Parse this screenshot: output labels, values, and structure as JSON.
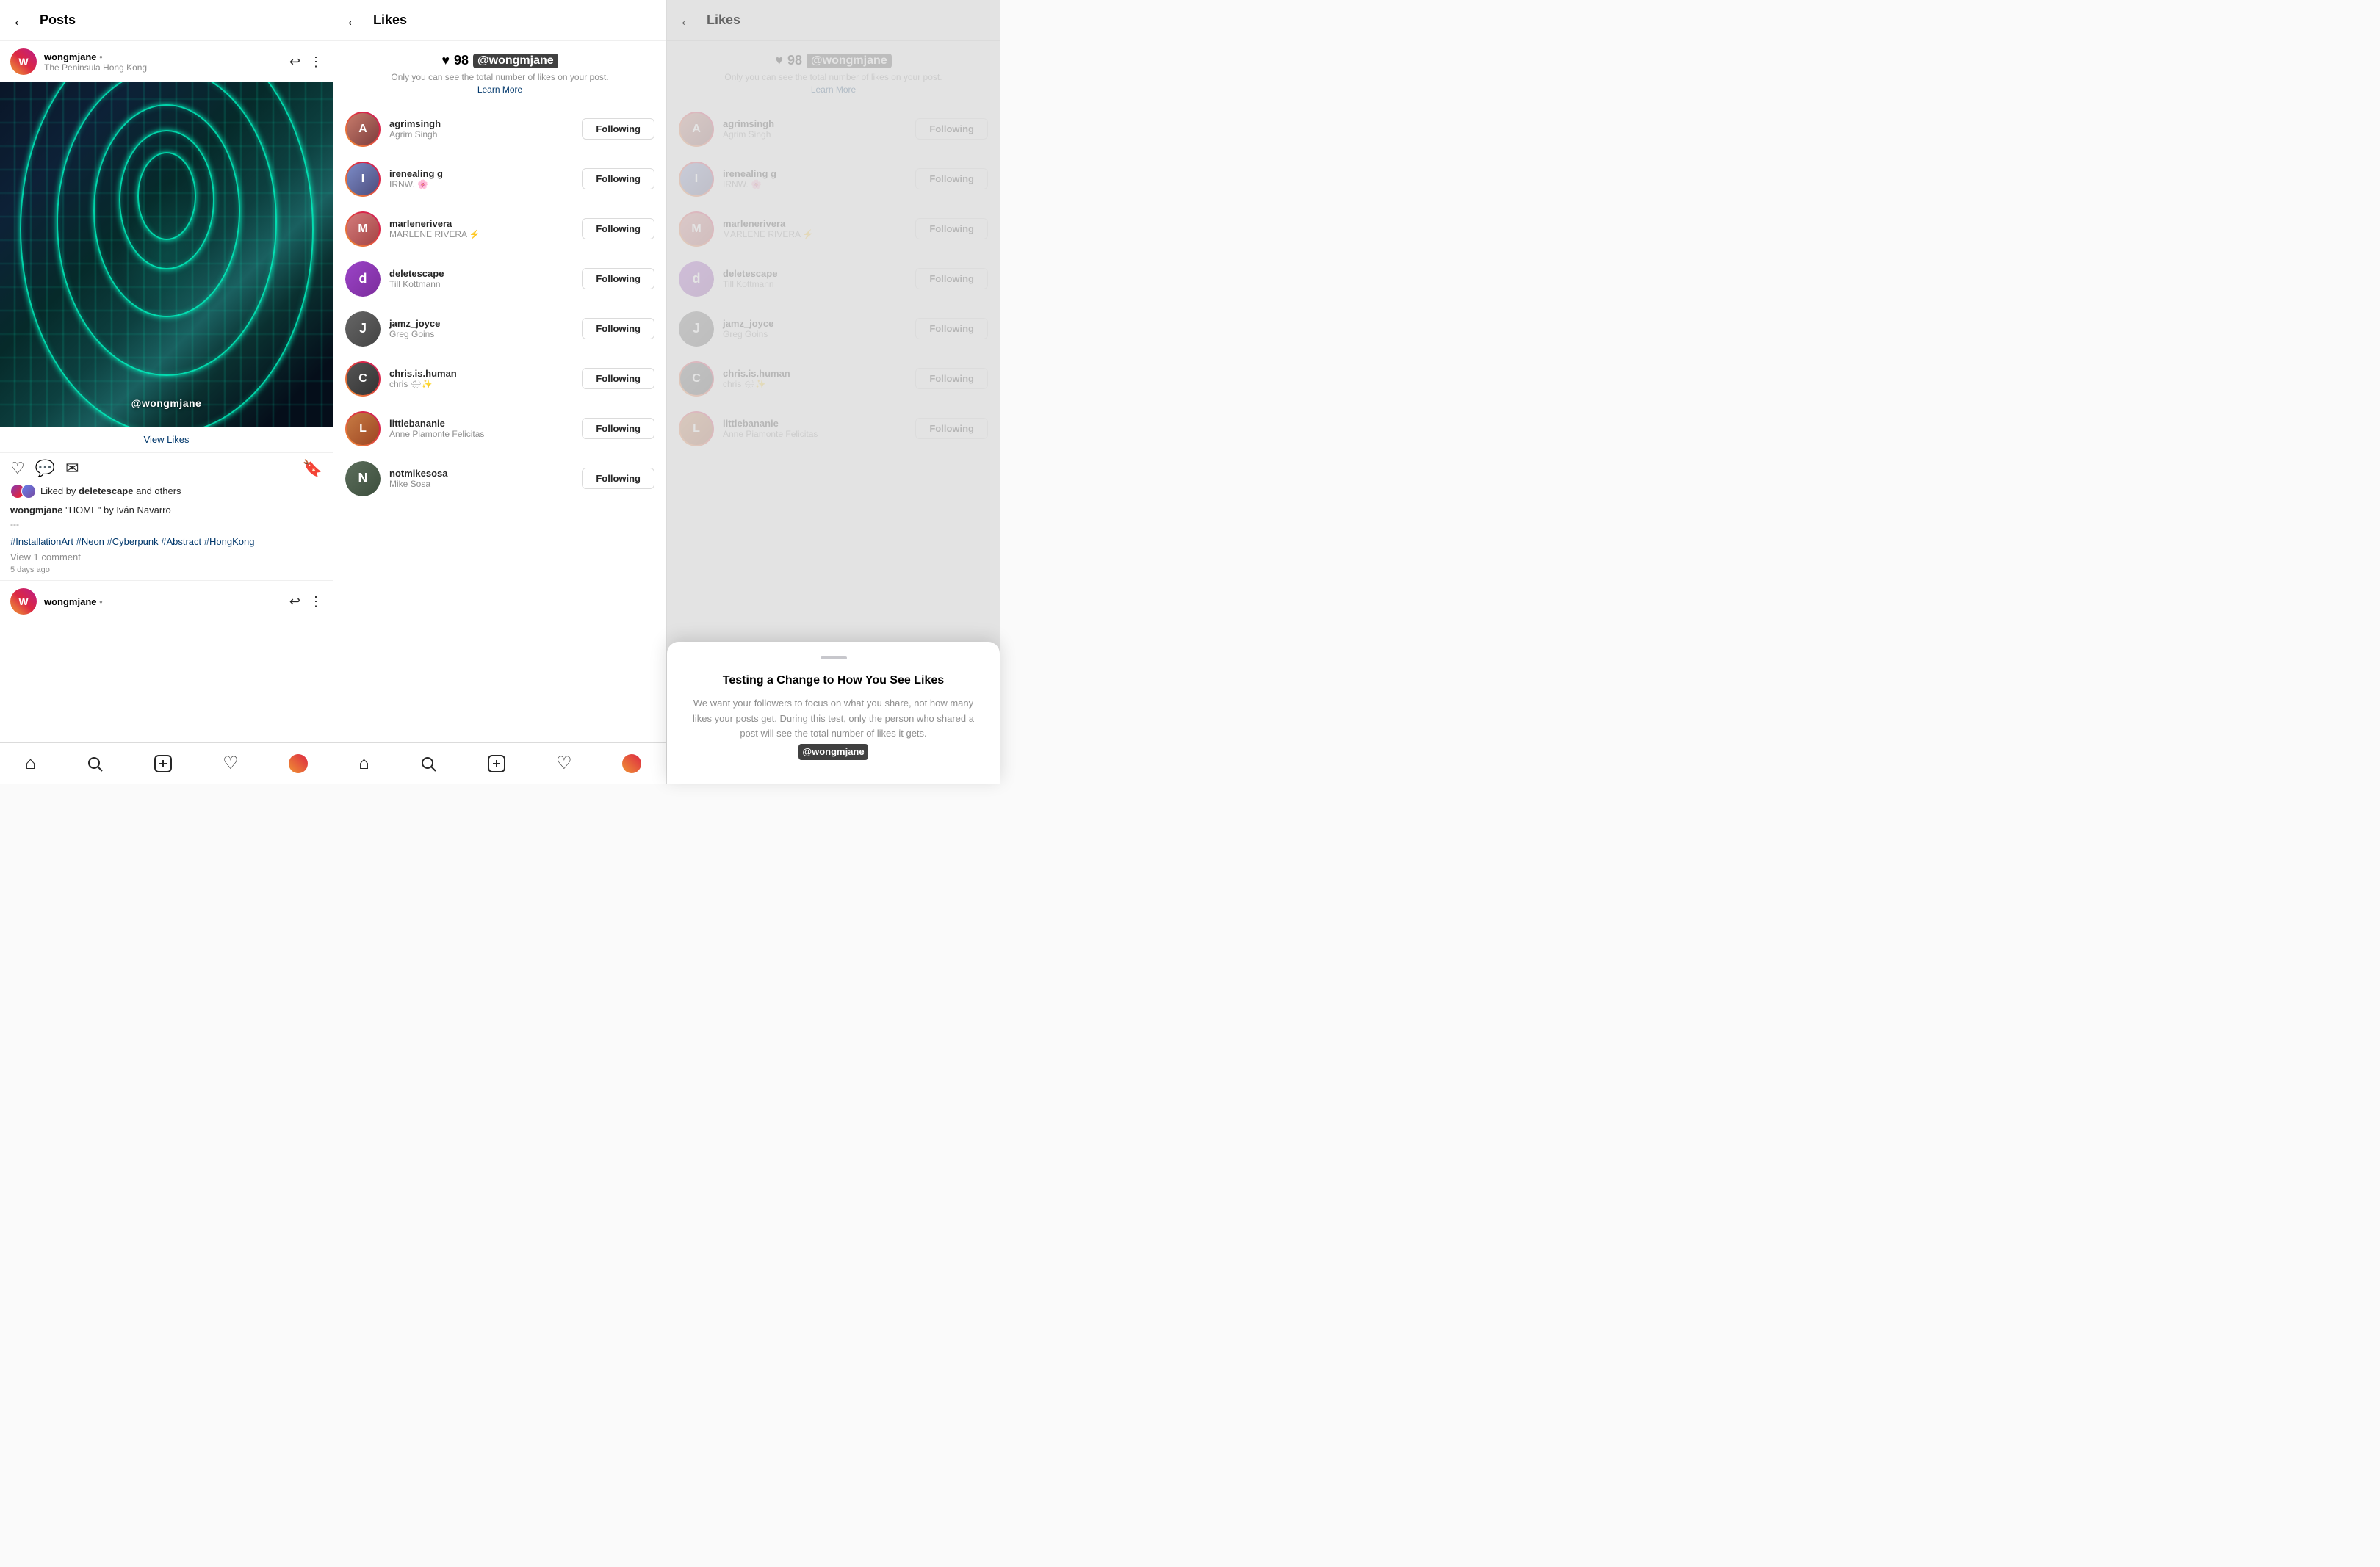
{
  "panel1": {
    "header": {
      "back": "←",
      "title": "Posts"
    },
    "post": {
      "username": "wongmjane",
      "dot": "•",
      "subtitle": "The Peninsula Hong Kong",
      "watermark": "@wongmjane",
      "view_likes": "View Likes",
      "liked_by_prefix": "Liked by",
      "liked_by_bold": "deletescape",
      "liked_by_suffix": "and others",
      "caption_user": "wongmjane",
      "caption_text": " \"HOME\" by Iván Navarro",
      "caption_sep": "---",
      "caption_tags": "#InstallationArt #Neon #Cyberpunk #Abstract #HongKong",
      "view_comments": "View 1 comment",
      "timestamp": "5 days ago"
    },
    "nav": {
      "home": "⌂",
      "search": "🔍",
      "add": "+",
      "heart": "♡",
      "profile": ""
    }
  },
  "panel2": {
    "header": {
      "back": "←",
      "title": "Likes"
    },
    "likes_count": "98",
    "watermark": "@wongmjane",
    "notice": "Only you can see the total number of likes on your post.",
    "learn_more": "Learn More",
    "users": [
      {
        "username": "agrimsingh",
        "display": "Agrim Singh",
        "ring": "gradient",
        "color1": "#b56c6c",
        "color2": "#6c4444",
        "letter": "A"
      },
      {
        "username": "irenealing g",
        "display": "IRNW. 🌸",
        "ring": "gradient",
        "color1": "#6c7db5",
        "color2": "#4a4a6c",
        "letter": "I"
      },
      {
        "username": "marlenerivera",
        "display": "MARLENE RIVERA ⚡",
        "ring": "gradient",
        "color1": "#c46c6c",
        "color2": "#b54444",
        "letter": "M"
      },
      {
        "username": "deletescape",
        "display": "Till Kottmann",
        "ring": "none",
        "color1": "#8b44b5",
        "color2": "#6c2d8c",
        "letter": "d"
      },
      {
        "username": "jamz_joyce",
        "display": "Greg Goins",
        "ring": "none",
        "color1": "#555",
        "color2": "#333",
        "letter": "J"
      },
      {
        "username": "chris.is.human",
        "display": "chris 🌧✨",
        "ring": "gradient",
        "color1": "#4a4a4a",
        "color2": "#2a2a2a",
        "letter": "C"
      },
      {
        "username": "littlebananie",
        "display": "Anne Piamonte Felicitas",
        "ring": "gradient",
        "color1": "#b56c44",
        "color2": "#8c4422",
        "letter": "L"
      },
      {
        "username": "notmikesosa",
        "display": "Mike Sosa",
        "ring": "none",
        "color1": "#4a5a4a",
        "color2": "#2a3a2a",
        "letter": "N"
      }
    ],
    "following_label": "Following"
  },
  "panel3": {
    "header": {
      "back": "←",
      "title": "Likes"
    },
    "likes_count": "98",
    "watermark": "@wongmjane",
    "notice": "Only you can see the total number of likes on your post.",
    "learn_more": "Learn More",
    "users": [
      {
        "username": "agrimsingh",
        "display": "Agrim Singh",
        "ring": "gradient",
        "color1": "#b56c6c",
        "color2": "#6c4444",
        "letter": "A"
      },
      {
        "username": "irenealing g",
        "display": "IRNW. 🌸",
        "ring": "gradient",
        "color1": "#6c7db5",
        "color2": "#4a4a6c",
        "letter": "I"
      },
      {
        "username": "marlenerivera",
        "display": "MARLENE RIVERA ⚡",
        "ring": "gradient",
        "color1": "#c46c6c",
        "color2": "#b54444",
        "letter": "M"
      },
      {
        "username": "deletescape",
        "display": "Till Kottmann",
        "ring": "none",
        "color1": "#8b44b5",
        "color2": "#6c2d8c",
        "letter": "d"
      },
      {
        "username": "jamz_joyce",
        "display": "Greg Goins",
        "ring": "none",
        "color1": "#555",
        "color2": "#333",
        "letter": "J"
      },
      {
        "username": "chris.is.human",
        "display": "chris 🌧✨",
        "ring": "gradient",
        "color1": "#4a4a4a",
        "color2": "#2a2a2a",
        "letter": "C"
      },
      {
        "username": "littlebananie",
        "display": "Anne Piamonte Felicitas",
        "ring": "gradient",
        "color1": "#b56c44",
        "color2": "#8c4422",
        "letter": "L"
      }
    ],
    "following_label": "Following",
    "modal": {
      "title": "Testing a Change to How You See Likes",
      "body": "We want your followers to focus on what you share, not how many likes your posts get. During this test, only the person who shared a post will see the total number of likes it gets.",
      "watermark": "@wongmjane"
    }
  }
}
